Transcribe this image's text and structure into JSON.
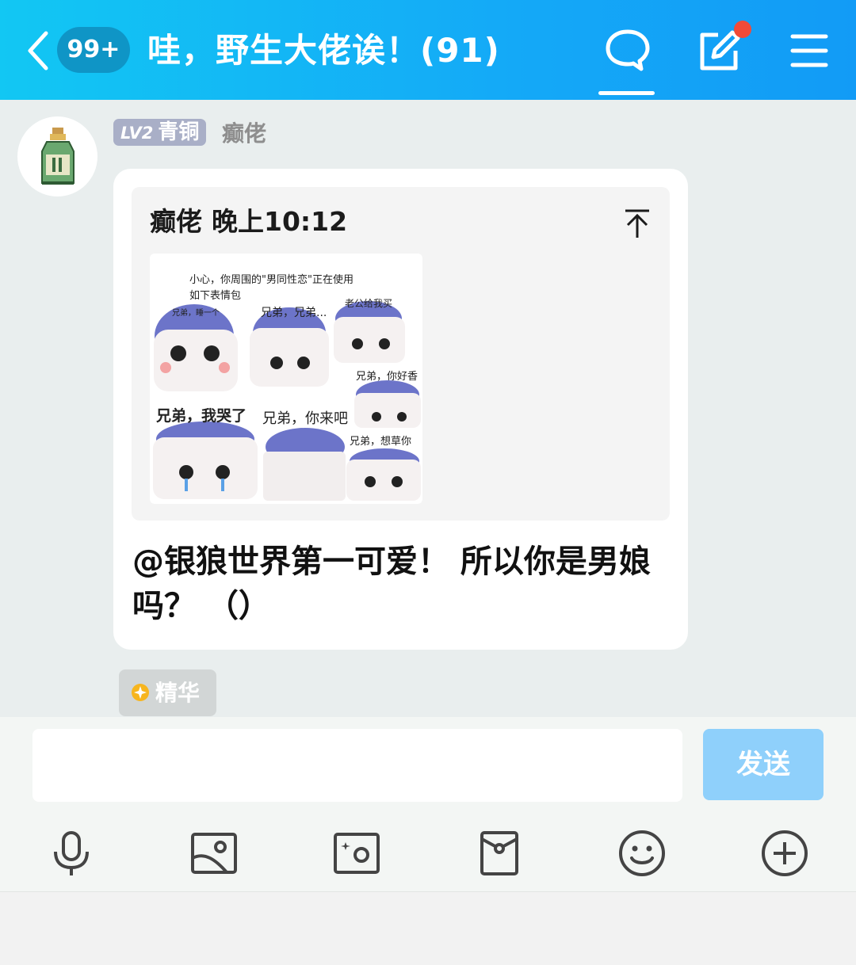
{
  "header": {
    "unread_badge": "99+",
    "title": "哇，野生大佬诶！(91)",
    "icons": [
      "back-icon",
      "chat-bubble-icon",
      "edit-icon",
      "menu-icon"
    ]
  },
  "message": {
    "level": "LV2",
    "rank": "青铜",
    "username": "癫佬",
    "quote": {
      "author": "癫佬",
      "time": "晚上10:12",
      "image_captions": {
        "title1": "小心，你周围的\"男同性恋\"正在使用",
        "title2": "如下表情包",
        "c1": "兄弟，睡一个",
        "c2": "兄弟，兄弟...",
        "c3": "老公给我买",
        "c4": "兄弟，你好香",
        "c5": "兄弟，我哭了",
        "c6": "兄弟，你来吧",
        "c7": "兄弟，想草你"
      }
    },
    "text": "@银狼世界第一可爱！  所以你是男娘吗？ （）",
    "essence_label": "精华"
  },
  "composer": {
    "input_value": "",
    "send_label": "发送",
    "tools": [
      "microphone-icon",
      "image-icon",
      "camera-icon",
      "red-packet-icon",
      "emoji-icon",
      "plus-icon"
    ]
  },
  "colors": {
    "header_start": "#12c7f3",
    "header_end": "#129bf6",
    "send_disabled": "#8fd0fb",
    "notification_dot": "#f24a38"
  }
}
